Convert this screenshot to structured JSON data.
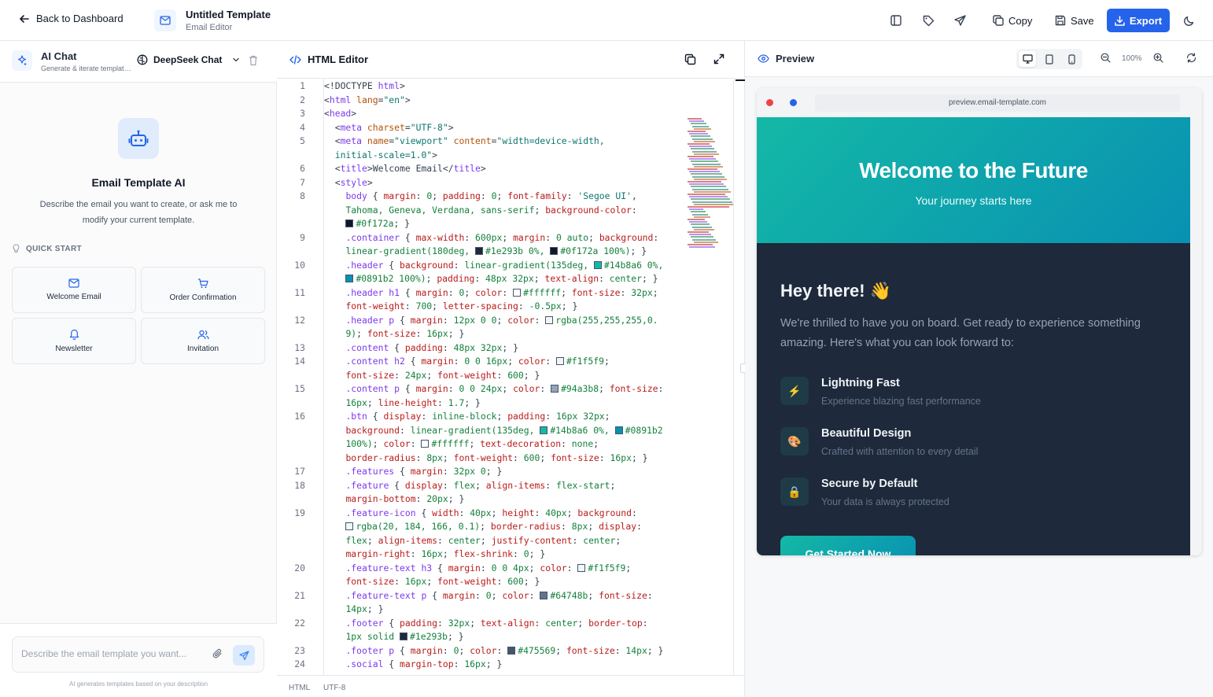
{
  "topbar": {
    "back_label": "Back to Dashboard",
    "template_title": "Untitled Template",
    "template_subtitle": "Email Editor",
    "copy_label": "Copy",
    "save_label": "Save",
    "export_label": "Export",
    "accent_color": "#2563eb"
  },
  "chat": {
    "title": "AI Chat",
    "subtitle": "Generate & iterate templates",
    "model": "DeepSeek Chat",
    "assistant_title": "Email Template AI",
    "assistant_desc": "Describe the email you want to create, or ask me to modify your current template.",
    "quick_start_label": "QUICK START",
    "quick_start": [
      {
        "label": "Welcome Email",
        "icon": "mail-icon"
      },
      {
        "label": "Order Confirmation",
        "icon": "cart-icon"
      },
      {
        "label": "Newsletter",
        "icon": "bell-icon"
      },
      {
        "label": "Invitation",
        "icon": "users-icon"
      }
    ],
    "input_placeholder": "Describe the email template you want...",
    "footer_note": "AI generates templates based on your description"
  },
  "editor": {
    "title": "HTML Editor",
    "footer_lang": "HTML",
    "footer_encoding": "UTF-8",
    "line_numbers": [
      "1",
      "2",
      "3",
      "4",
      "5",
      "",
      "6",
      "7",
      "8",
      "",
      "",
      "9",
      "",
      "10",
      "",
      "11",
      "",
      "12",
      "",
      "13",
      "14",
      "",
      "15",
      "",
      "16",
      "",
      "",
      "",
      "17",
      "18",
      "",
      "19",
      "",
      "",
      "",
      "20",
      "",
      "21",
      "",
      "22",
      "",
      "23",
      "24"
    ]
  },
  "preview": {
    "title": "Preview",
    "zoom": "100%",
    "url": "preview.email-template.com",
    "email": {
      "header_title": "Welcome to the Future",
      "header_subtitle": "Your journey starts here",
      "greeting": "Hey there! 👋",
      "intro": "We're thrilled to have you on board. Get ready to experience something amazing. Here's what you can look forward to:",
      "features": [
        {
          "title": "Lightning Fast",
          "desc": "Experience blazing fast performance",
          "icon": "⚡"
        },
        {
          "title": "Beautiful Design",
          "desc": "Crafted with attention to every detail",
          "icon": "🎨"
        },
        {
          "title": "Secure by Default",
          "desc": "Your data is always protected",
          "icon": "🔒"
        }
      ],
      "cta_label": "Get Started Now"
    }
  }
}
